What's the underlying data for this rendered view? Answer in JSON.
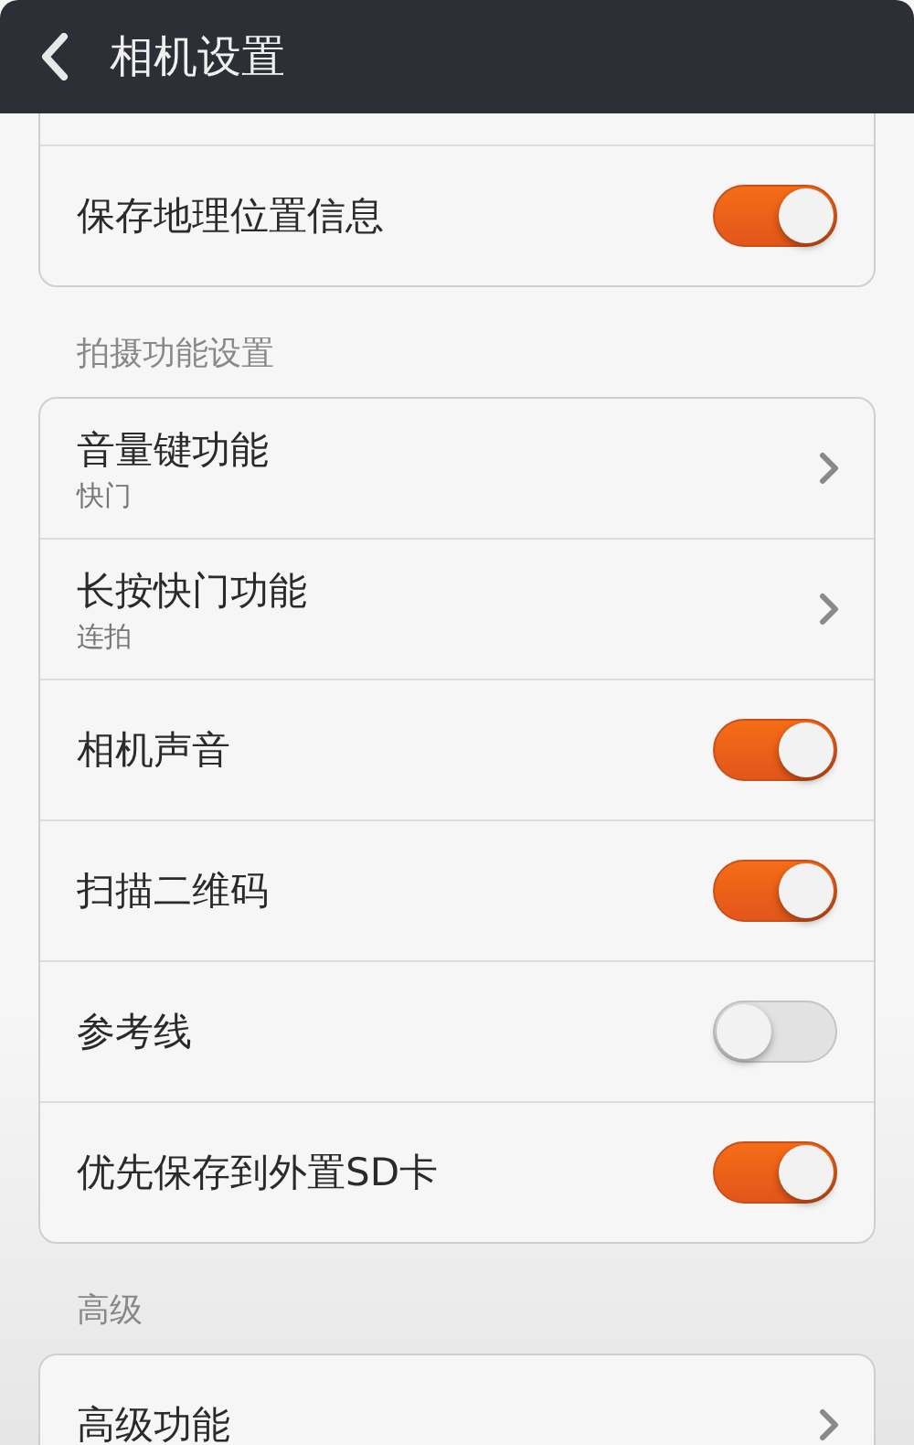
{
  "header": {
    "title": "相机设置"
  },
  "sections": [
    {
      "items": [
        {
          "kind": "toggle",
          "title": "保存地理位置信息",
          "on": true
        }
      ]
    },
    {
      "label": "拍摄功能设置",
      "items": [
        {
          "kind": "link",
          "title": "音量键功能",
          "subtitle": "快门"
        },
        {
          "kind": "link",
          "title": "长按快门功能",
          "subtitle": "连拍"
        },
        {
          "kind": "toggle",
          "title": "相机声音",
          "on": true
        },
        {
          "kind": "toggle",
          "title": "扫描二维码",
          "on": true
        },
        {
          "kind": "toggle",
          "title": "参考线",
          "on": false
        },
        {
          "kind": "toggle",
          "title": "优先保存到外置SD卡",
          "on": true
        }
      ]
    },
    {
      "label": "高级",
      "items": [
        {
          "kind": "link",
          "title": "高级功能"
        }
      ]
    }
  ]
}
